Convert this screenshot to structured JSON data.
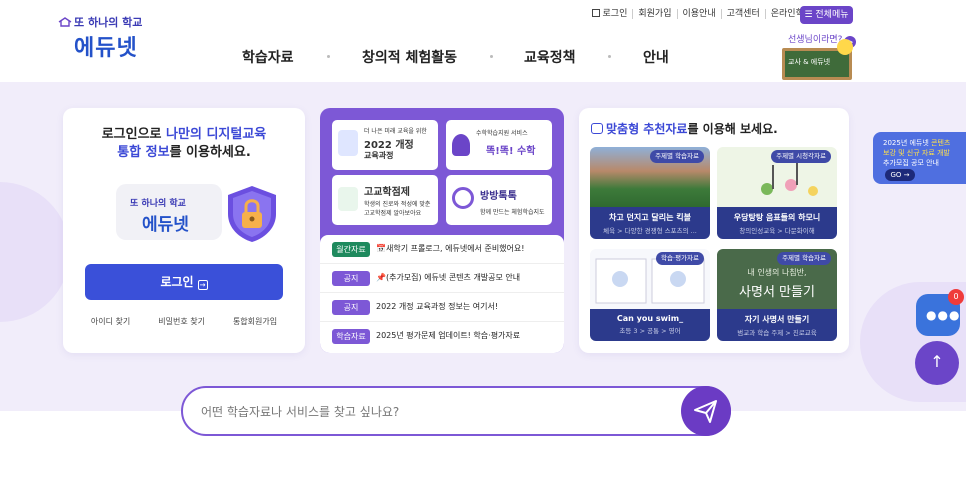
{
  "header": {
    "logo_tagline": "또 하나의 학교",
    "logo_name": "에듀넷",
    "util_links": [
      "로그인",
      "회원가입",
      "이용안내",
      "고객센터",
      "온라인학습서비스"
    ],
    "menu_all": "전체메뉴",
    "teacher_link": "선생님이라면?",
    "teacher_board": "교사 & 에듀넷",
    "nav": [
      "학습자료",
      "창의적 체험활동",
      "교육정책",
      "안내"
    ]
  },
  "login": {
    "msg_pre": "로그인으로 ",
    "msg_hl1": "나만의 디지털교육",
    "msg_hl2": "통합 정보",
    "msg_post": "를 이용하세요.",
    "logo_tagline": "또 하나의 학교",
    "logo_name": "에듀넷",
    "button": "로그인",
    "links": [
      "아이디 찾기",
      "비밀번호 찾기",
      "통합회원가입"
    ]
  },
  "tiles": [
    {
      "small": "더 나은 미래 교육을 위한",
      "big1": "2022 개정",
      "big2": "교육과정"
    },
    {
      "small": "수학학습지원 서비스",
      "big1": "똑!똑! 수학"
    },
    {
      "big1": "고교학점제",
      "small1": "학생의 진로와 적성에 맞춘",
      "small2": "고교학점제 알아보아요"
    },
    {
      "big1": "방방톡톡",
      "small": "함께 만드는 체험학습지도"
    }
  ],
  "notices": [
    {
      "badge": "월간자료",
      "color": "#1f8a5e",
      "text": "새학기 프롤로그, 에듀넷에서 준비했어요!"
    },
    {
      "badge": "공지",
      "color": "#7d58d6",
      "text": "(추가모집) 에듀넷 콘텐츠 개발공모 안내"
    },
    {
      "badge": "공지",
      "color": "#7d58d6",
      "text": "2022 개정 교육과정 정보는 여기서!"
    },
    {
      "badge": "학습자료",
      "color": "#7d58d6",
      "text": "2025년 평가문제 업데이트! 학습·평가자료"
    }
  ],
  "recommend": {
    "head_hl": "맞춤형 추천자료",
    "head_post": "를 이용해 보세요.",
    "items": [
      {
        "tag": "주제별 학습자료",
        "title": "차고 던지고 달리는 킥볼",
        "sub": "체육 > 다양한 경쟁형 스포츠의 ..."
      },
      {
        "tag": "주제별 시청각자료",
        "title": "우당탕탕 음표들의 하모니",
        "sub": "창의인성교육 > 다문화이해"
      },
      {
        "tag": "학습·평가자료",
        "title": "Can you swim_",
        "sub": "초등 3 > 공통 > 영어"
      },
      {
        "tag": "주제별 학습자료",
        "title": "자기 사명서 만들기",
        "sub": "범교과 학습 주제 > 진로교육"
      }
    ],
    "board_text1": "내 인생의 나침반,",
    "board_text2": "사명서 만들기"
  },
  "banner": {
    "l1": "2025년 에듀넷",
    "l2": "콘텐츠",
    "l3": "보강 및 신규 자료 개발",
    "l4": "추가모집",
    "l5": "공모 안내",
    "go": "GO"
  },
  "chat_count": "0",
  "search": {
    "placeholder": "어떤 학습자료나 서비스를 찾고 싶나요?"
  }
}
